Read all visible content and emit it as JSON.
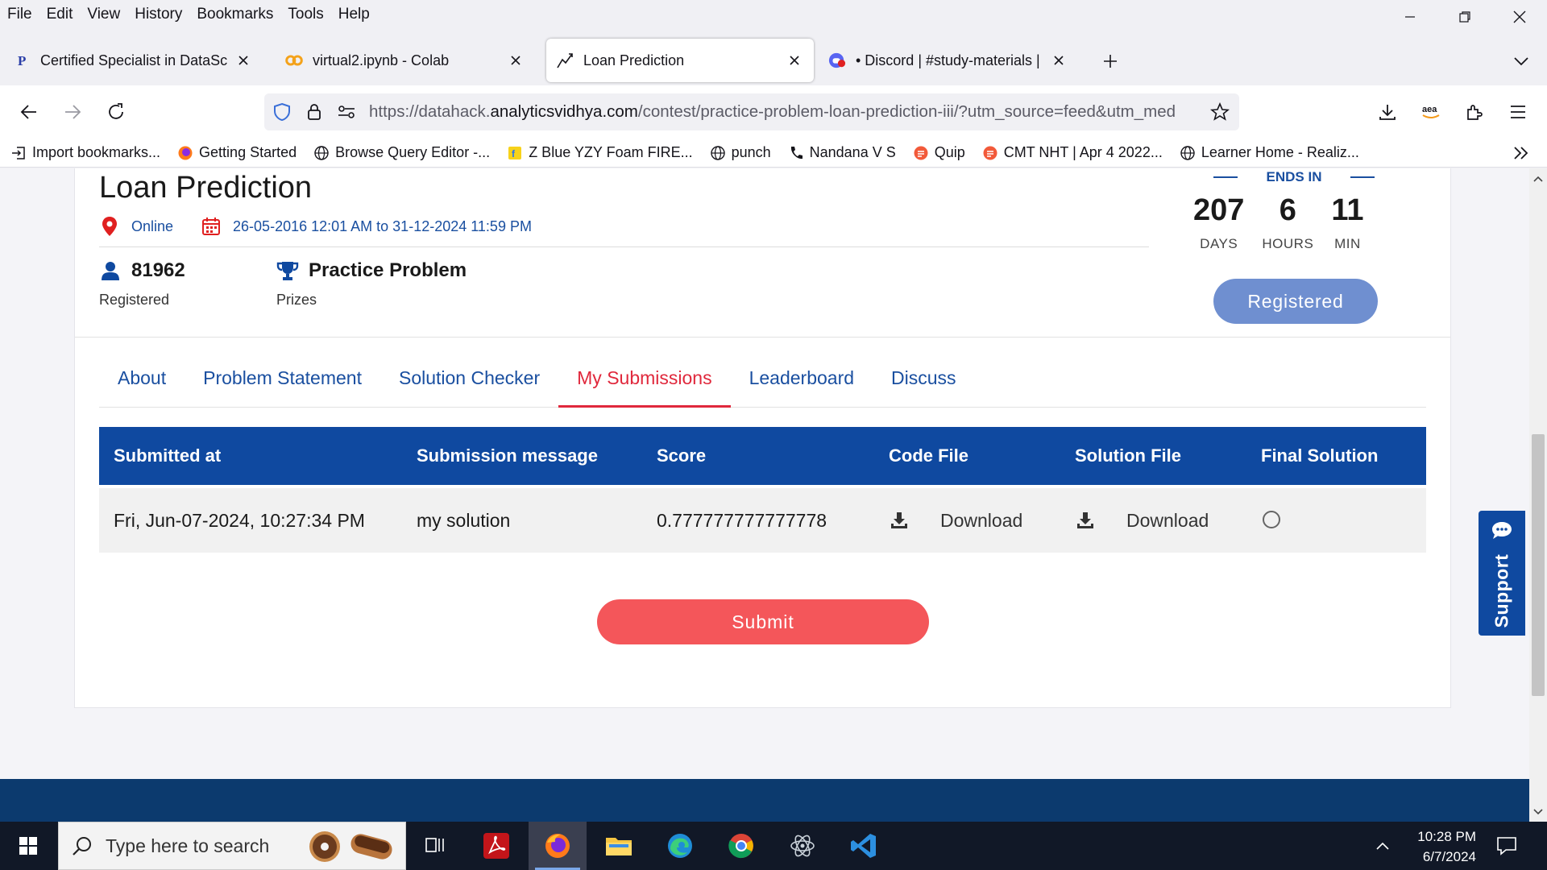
{
  "menu": [
    "File",
    "Edit",
    "View",
    "History",
    "Bookmarks",
    "Tools",
    "Help"
  ],
  "tabs": [
    {
      "title": "Certified Specialist in DataScien",
      "icon": "p-icon"
    },
    {
      "title": "virtual2.ipynb - Colab",
      "icon": "colab-icon"
    },
    {
      "title": "Loan Prediction",
      "icon": "chart-icon"
    },
    {
      "title": "• Discord | #study-materials | D",
      "icon": "discord-icon"
    }
  ],
  "url": {
    "prefix": "https://datahack.",
    "domain": "analyticsvidhya.com",
    "path": "/contest/practice-problem-loan-prediction-iii/?utm_source=feed&utm_med"
  },
  "bookmarks": [
    "Import bookmarks...",
    "Getting Started",
    "Browse Query Editor -...",
    "Z Blue YZY Foam FIRE...",
    "punch",
    "Nandana V S",
    "Quip",
    "CMT NHT | Apr 4 2022...",
    "Learner Home - Realiz..."
  ],
  "contest": {
    "title": "Loan Prediction",
    "location": "Online",
    "dates": "26-05-2016 12:01 AM to 31-12-2024 11:59 PM",
    "registered_count": "81962",
    "registered_label": "Registered",
    "prize_value": "Practice Problem",
    "prize_label": "Prizes",
    "ends_in_label": "ENDS IN",
    "countdown": [
      {
        "value": "207",
        "unit": "DAYS"
      },
      {
        "value": "6",
        "unit": "HOURS"
      },
      {
        "value": "11",
        "unit": "MIN"
      }
    ],
    "registered_button": "Registered"
  },
  "content_tabs": [
    "About",
    "Problem Statement",
    "Solution Checker",
    "My Submissions",
    "Leaderboard",
    "Discuss"
  ],
  "active_tab": "My Submissions",
  "table": {
    "headers": [
      "Submitted at",
      "Submission message",
      "Score",
      "Code File",
      "Solution File",
      "Final Solution"
    ],
    "rows": [
      {
        "submitted_at": "Fri, Jun-07-2024, 10:27:34 PM",
        "message": "my solution",
        "score": "0.777777777777778",
        "code_file": "Download",
        "solution_file": "Download"
      }
    ]
  },
  "submit_label": "Submit",
  "support_label": "Support",
  "taskbar": {
    "search_placeholder": "Type here to search",
    "time": "10:28 PM",
    "date": "6/7/2024"
  },
  "colors": {
    "primary_blue": "#0f49a0",
    "active_red": "#e0283c",
    "submit_coral": "#f4565a",
    "registered_blue": "#6f8fd0"
  }
}
